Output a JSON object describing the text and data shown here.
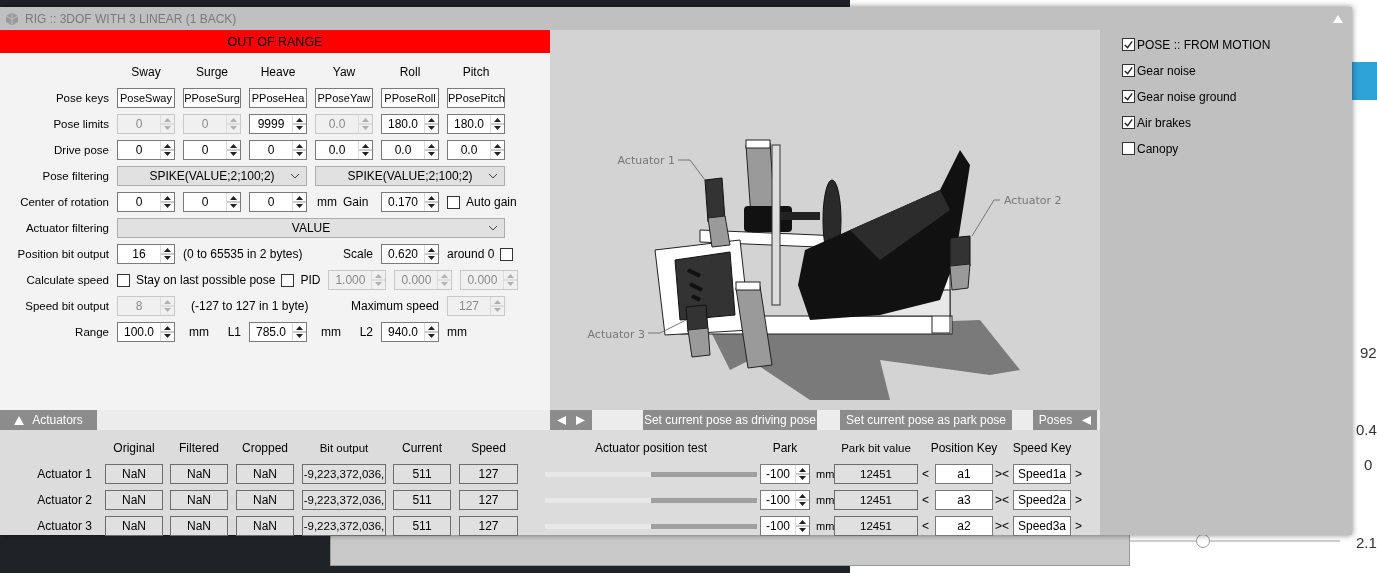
{
  "window": {
    "title": "RIG :: 3DOF WITH 3 LINEAR (1 BACK)"
  },
  "status_banner": "OUT OF RANGE",
  "pose_table": {
    "columns": [
      "Sway",
      "Surge",
      "Heave",
      "Yaw",
      "Roll",
      "Pitch"
    ],
    "rows": [
      {
        "label": "Pose keys",
        "kind": "text",
        "cells": [
          {
            "value": "PoseSway",
            "disabled": false
          },
          {
            "value": "PPoseSurg",
            "disabled": false
          },
          {
            "value": "PPoseHea",
            "disabled": false
          },
          {
            "value": "PPoseYaw",
            "disabled": false
          },
          {
            "value": "PPoseRoll",
            "disabled": false
          },
          {
            "value": "PPosePitch",
            "disabled": false
          }
        ]
      },
      {
        "label": "Pose limits",
        "kind": "spin",
        "cells": [
          {
            "value": "0",
            "disabled": true
          },
          {
            "value": "0",
            "disabled": true
          },
          {
            "value": "9999",
            "disabled": false
          },
          {
            "value": "0.0",
            "disabled": true
          },
          {
            "value": "180.0",
            "disabled": false
          },
          {
            "value": "180.0",
            "disabled": false
          }
        ]
      },
      {
        "label": "Drive pose",
        "kind": "spin",
        "cells": [
          {
            "value": "0",
            "disabled": false
          },
          {
            "value": "0",
            "disabled": false
          },
          {
            "value": "0",
            "disabled": false
          },
          {
            "value": "0.0",
            "disabled": false
          },
          {
            "value": "0.0",
            "disabled": false
          },
          {
            "value": "0.0",
            "disabled": false
          }
        ]
      }
    ]
  },
  "pose_filtering": {
    "label": "Pose filtering",
    "values": [
      "SPIKE(VALUE;2;100;2)",
      "SPIKE(VALUE;2;100;2)"
    ]
  },
  "center_of_rotation": {
    "label": "Center of rotation",
    "values": [
      "0",
      "0",
      "0"
    ],
    "unit": "mm",
    "gain_label": "Gain",
    "gain": "0.170",
    "auto_gain": {
      "label": "Auto gain",
      "checked": false
    }
  },
  "actuator_filtering": {
    "label": "Actuator filtering",
    "value": "VALUE"
  },
  "position_bit_output": {
    "label": "Position bit output",
    "value": "16",
    "note": "(0 to 65535 in 2 bytes)",
    "scale_label": "Scale",
    "scale": "0.620",
    "around_zero": {
      "label": "around 0",
      "checked": false
    }
  },
  "calculate_speed": {
    "label": "Calculate speed",
    "checked": false,
    "stay": {
      "label": "Stay on last possible pose",
      "checked": false
    },
    "pid_label": "PID",
    "pid_values": [
      {
        "value": "1.000",
        "disabled": true
      },
      {
        "value": "0.000",
        "disabled": true
      },
      {
        "value": "0.000",
        "disabled": true
      }
    ]
  },
  "speed_bit_output": {
    "label": "Speed bit output",
    "value": "8",
    "disabled": true,
    "note": "(-127 to 127 in 1 byte)",
    "max_label": "Maximum speed",
    "max": "127",
    "max_disabled": true
  },
  "range": {
    "label": "Range",
    "value": "100.0",
    "unit": "mm",
    "l1_label": "L1",
    "l1": "785.0",
    "l1_unit": "mm",
    "l2_label": "L2",
    "l2": "940.0",
    "l2_unit": "mm"
  },
  "viewport": {
    "callouts": [
      "Actuator 1",
      "Actuator 2",
      "Actuator 3"
    ]
  },
  "options": [
    {
      "label": "POSE :: FROM MOTION",
      "checked": true
    },
    {
      "label": "Gear noise",
      "checked": true
    },
    {
      "label": "Gear noise ground",
      "checked": true
    },
    {
      "label": "Air brakes",
      "checked": true
    },
    {
      "label": "Canopy",
      "checked": false
    }
  ],
  "tabs": {
    "actuators": "Actuators",
    "buttons": [
      "Set current pose as driving pose",
      "Set current pose as park pose"
    ],
    "poses": "Poses"
  },
  "actuators": {
    "columns": [
      "Original",
      "Filtered",
      "Cropped",
      "Bit output",
      "Current",
      "Speed",
      "Actuator position test",
      "Park",
      "Park bit value",
      "Position Key",
      "Speed Key"
    ],
    "rows": [
      {
        "name": "Actuator 1",
        "original": "NaN",
        "filtered": "NaN",
        "cropped": "NaN",
        "bit_output": "-9,223,372,036,",
        "current": "511",
        "speed": "127",
        "level": 0.5,
        "park": "-100",
        "unit": "mm",
        "park_bit": "12451",
        "open": "<",
        "position_key": "a1",
        "mid": "><",
        "speed_key": "Speed1a",
        "close": ">"
      },
      {
        "name": "Actuator 2",
        "original": "NaN",
        "filtered": "NaN",
        "cropped": "NaN",
        "bit_output": "-9,223,372,036,",
        "current": "511",
        "speed": "127",
        "level": 0.5,
        "park": "-100",
        "unit": "mm",
        "park_bit": "12451",
        "open": "<",
        "position_key": "a3",
        "mid": "><",
        "speed_key": "Speed2a",
        "close": ">"
      },
      {
        "name": "Actuator 3",
        "original": "NaN",
        "filtered": "NaN",
        "cropped": "NaN",
        "bit_output": "-9,223,372,036,",
        "current": "511",
        "speed": "127",
        "level": 0.5,
        "park": "-100",
        "unit": "mm",
        "park_bit": "12451",
        "open": "<",
        "position_key": "a2",
        "mid": "><",
        "speed_key": "Speed3a",
        "close": ">"
      }
    ]
  },
  "background": {
    "values": [
      "92",
      "0.4",
      "0",
      "2.1"
    ]
  }
}
